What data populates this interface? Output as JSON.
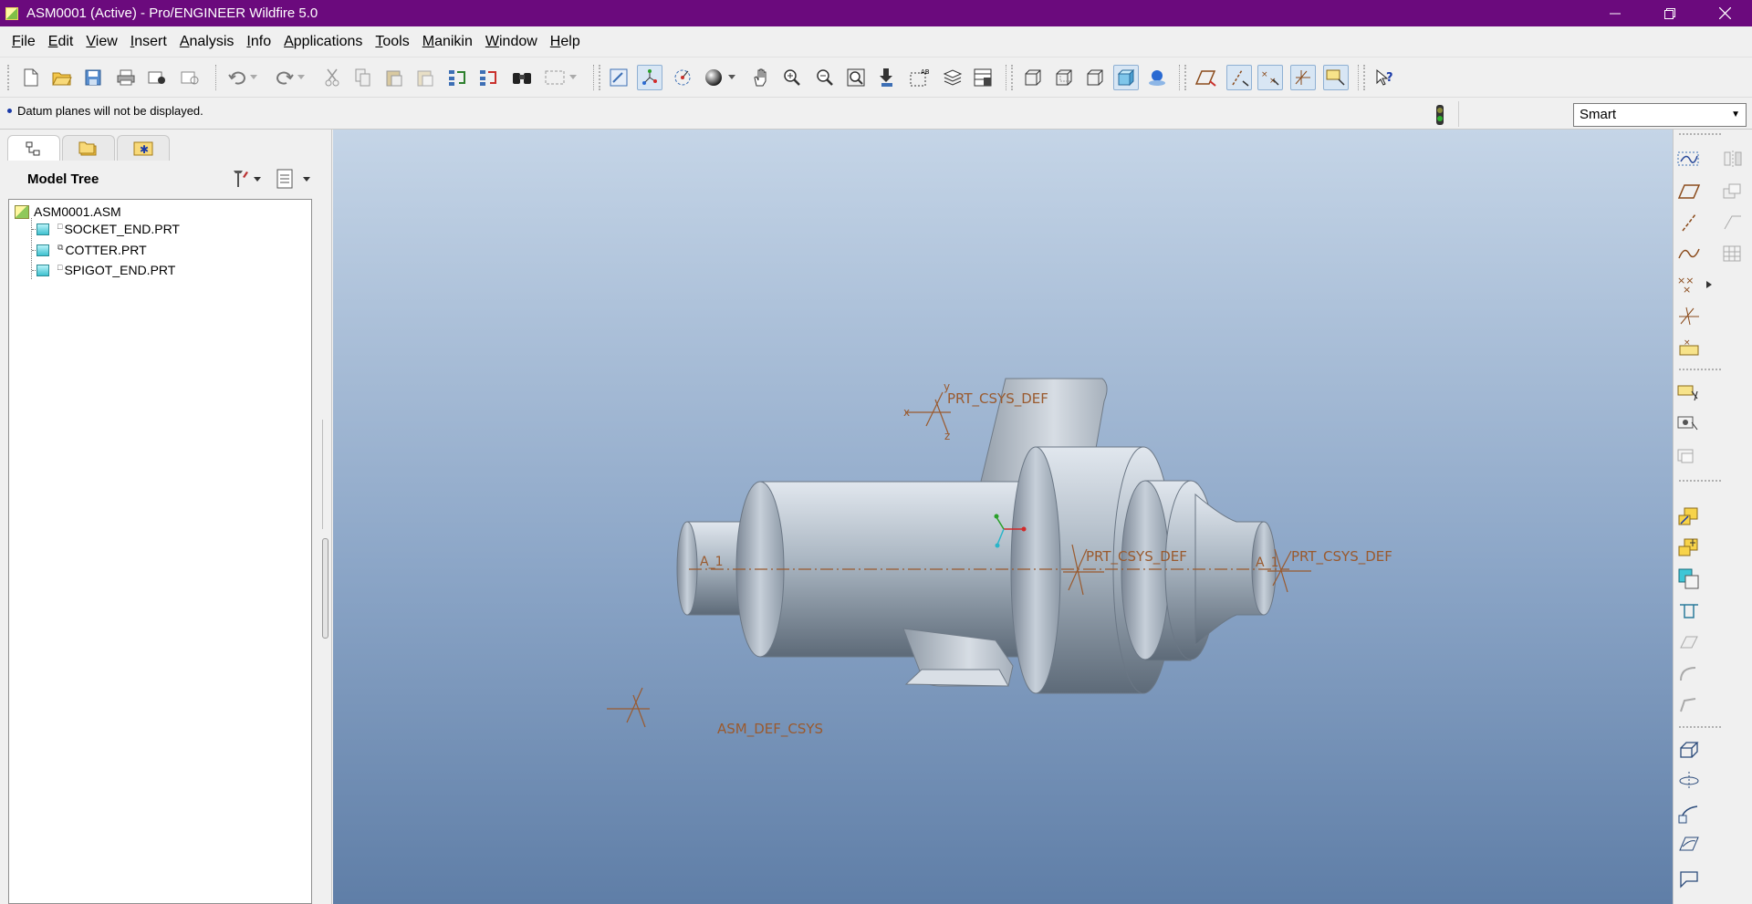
{
  "window": {
    "title": "ASM0001 (Active) - Pro/ENGINEER Wildfire 5.0",
    "controls": [
      "minimize",
      "restore",
      "close"
    ]
  },
  "menubar": {
    "items": [
      {
        "label": "File",
        "mnemonic": "F",
        "rest": "ile"
      },
      {
        "label": "Edit",
        "mnemonic": "E",
        "rest": "dit"
      },
      {
        "label": "View",
        "mnemonic": "V",
        "rest": "iew"
      },
      {
        "label": "Insert",
        "mnemonic": "I",
        "rest": "nsert"
      },
      {
        "label": "Analysis",
        "mnemonic": "A",
        "rest": "nalysis"
      },
      {
        "label": "Info",
        "mnemonic": "I",
        "rest": "nfo"
      },
      {
        "label": "Applications",
        "mnemonic": "A",
        "rest": "pplications"
      },
      {
        "label": "Tools",
        "mnemonic": "T",
        "rest": "ools"
      },
      {
        "label": "Manikin",
        "mnemonic": "M",
        "rest": "anikin"
      },
      {
        "label": "Window",
        "mnemonic": "W",
        "rest": "indow"
      },
      {
        "label": "Help",
        "mnemonic": "H",
        "rest": "elp"
      }
    ]
  },
  "status": {
    "message": "Datum planes will not be displayed.",
    "filter_value": "Smart"
  },
  "left_panel": {
    "tabs": [
      "model-tree-tab",
      "folder-browser-tab",
      "favorites-tab"
    ],
    "model_tree_title": "Model Tree",
    "tree": {
      "root": "ASM0001.ASM",
      "children": [
        {
          "name": "SOCKET_END.PRT",
          "mark": "□"
        },
        {
          "name": "COTTER.PRT",
          "mark": "⧉"
        },
        {
          "name": "SPIGOT_END.PRT",
          "mark": "□"
        }
      ]
    }
  },
  "viewport": {
    "labels": {
      "csys_top": "PRT_CSYS_DEF",
      "csys_mid": "PRT_CSYS_DEF",
      "csys_right": "PRT_CSYS_DEF",
      "csys_asm": "ASM_DEF_CSYS",
      "axis_left": "A_1",
      "axis_right": "A_1",
      "axis_x": "x",
      "axis_y": "y",
      "axis_z": "z"
    }
  },
  "colors": {
    "titlebar": "#6b0a7d",
    "datum_label": "#9a5a2e",
    "viewport_top": "#c5d5e7",
    "viewport_bottom": "#5f7ea7"
  }
}
